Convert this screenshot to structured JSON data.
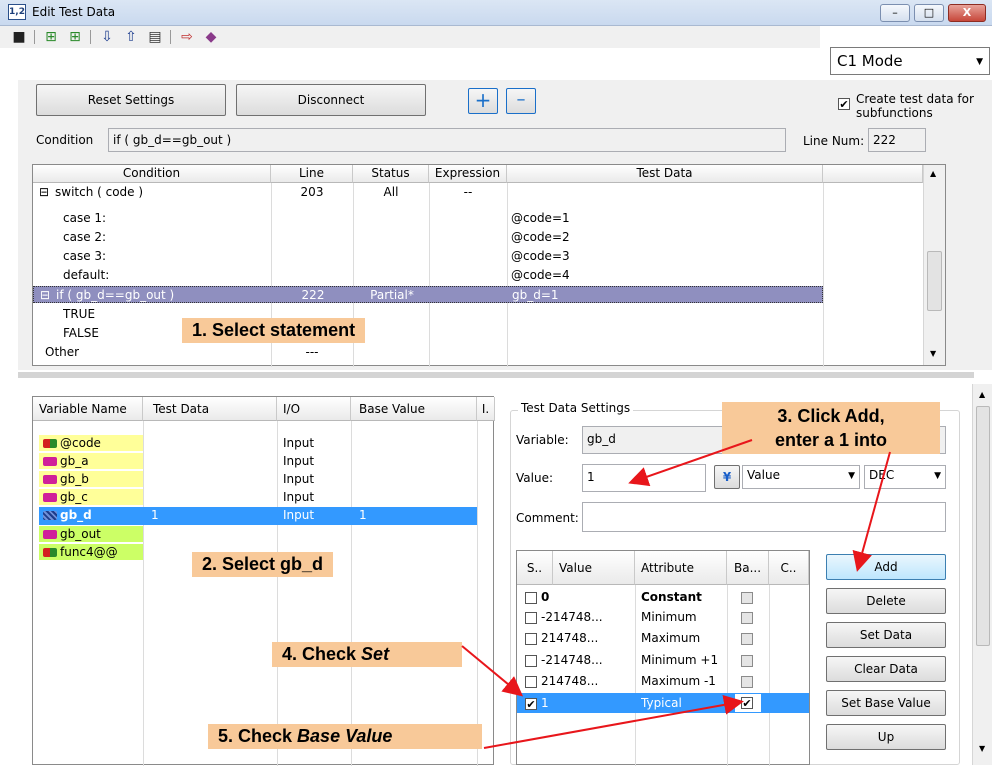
{
  "window": {
    "app_icon_label": "1,2",
    "title": "Edit Test Data",
    "minimize": "–",
    "maximize": "□",
    "close": "X"
  },
  "toolbar": {
    "icons": [
      "save-icon",
      "insert-row-icon",
      "insert-col-icon",
      "import-icon",
      "export-icon",
      "table-icon",
      "report-icon",
      "book-icon"
    ],
    "mode": "C1 Mode"
  },
  "top": {
    "reset_label": "Reset Settings",
    "disconnect_label": "Disconnect",
    "plus_label": "+",
    "minus_label": "–",
    "create_subfunctions_label": "Create test data for subfunctions",
    "create_subfunctions_checked": true,
    "condition_label": "Condition",
    "condition_value": "if ( gb_d==gb_out )",
    "line_num_label": "Line Num:",
    "line_num_value": "222"
  },
  "condition_table": {
    "headers": [
      "Condition",
      "Line",
      "Status",
      "Expression",
      "Test Data"
    ],
    "rows": [
      {
        "condition": "switch ( code )",
        "line": "203",
        "status": "All",
        "expression": "--",
        "test_data": ""
      },
      {
        "condition": "case 1:",
        "line": "",
        "status": "",
        "expression": "",
        "test_data": "@code=1"
      },
      {
        "condition": "case 2:",
        "line": "",
        "status": "",
        "expression": "",
        "test_data": "@code=2"
      },
      {
        "condition": "case 3:",
        "line": "",
        "status": "",
        "expression": "",
        "test_data": "@code=3"
      },
      {
        "condition": "default:",
        "line": "",
        "status": "",
        "expression": "",
        "test_data": "@code=4"
      },
      {
        "condition": "if ( gb_d==gb_out )",
        "line": "222",
        "status": "Partial*",
        "expression": "",
        "test_data": "gb_d=1"
      },
      {
        "condition": "TRUE",
        "line": "",
        "status": "",
        "expression": "",
        "test_data": ""
      },
      {
        "condition": "FALSE",
        "line": "",
        "status": "",
        "expression": "",
        "test_data": ""
      },
      {
        "condition": "Other",
        "line": "---",
        "status": "",
        "expression": "",
        "test_data": ""
      }
    ]
  },
  "variable_table": {
    "headers": [
      "Variable Name",
      "Test Data",
      "I/O",
      "Base Value",
      "I."
    ],
    "rows": [
      {
        "name": "@code",
        "test_data": "",
        "io": "Input",
        "base": ""
      },
      {
        "name": "gb_a",
        "test_data": "",
        "io": "Input",
        "base": ""
      },
      {
        "name": "gb_b",
        "test_data": "",
        "io": "Input",
        "base": ""
      },
      {
        "name": "gb_c",
        "test_data": "",
        "io": "Input",
        "base": ""
      },
      {
        "name": "gb_d",
        "test_data": "1",
        "io": "Input",
        "base": "1"
      },
      {
        "name": "gb_out",
        "test_data": "",
        "io": "",
        "base": ""
      },
      {
        "name": "func4@@",
        "test_data": "",
        "io": "",
        "base": ""
      }
    ]
  },
  "settings": {
    "group_label": "Test Data Settings",
    "variable_label": "Variable:",
    "variable_value": "gb_d",
    "value_label": "Value:",
    "value_value": "1",
    "type_select": "Value",
    "radix_select": "DEC",
    "comment_label": "Comment:",
    "comment_value": ""
  },
  "values_table": {
    "headers": [
      "S..",
      "Value",
      "Attribute",
      "Ba...",
      "C.."
    ],
    "rows": [
      {
        "set": false,
        "value": "0",
        "attribute": "Constant",
        "base": false
      },
      {
        "set": false,
        "value": "-214748...",
        "attribute": "Minimum",
        "base": false
      },
      {
        "set": false,
        "value": "214748...",
        "attribute": "Maximum",
        "base": false
      },
      {
        "set": false,
        "value": "-214748...",
        "attribute": "Minimum +1",
        "base": false
      },
      {
        "set": false,
        "value": "214748...",
        "attribute": "Maximum -1",
        "base": false
      },
      {
        "set": true,
        "value": "1",
        "attribute": "Typical",
        "base": true
      }
    ]
  },
  "side_buttons": {
    "add": "Add",
    "delete": "Delete",
    "set_data": "Set Data",
    "clear_data": "Clear Data",
    "set_base_value": "Set Base Value",
    "up": "Up"
  },
  "callouts": {
    "c1": "1. Select statement",
    "c2": "2. Select gb_d",
    "c3_line1": "3. Click Add,",
    "c3_line2": "enter a 1 into",
    "c4_prefix": "4. Check ",
    "c4_em": "Set",
    "c5_prefix": "5. Check ",
    "c5_em": "Base Value"
  },
  "colors": {
    "selection": "#3399ff",
    "tree_selection": "#8f8fbf",
    "callout": "#f8c999",
    "arrow": "#e8161b",
    "var_yellow": "#ffff99",
    "var_green": "#ccff66"
  }
}
